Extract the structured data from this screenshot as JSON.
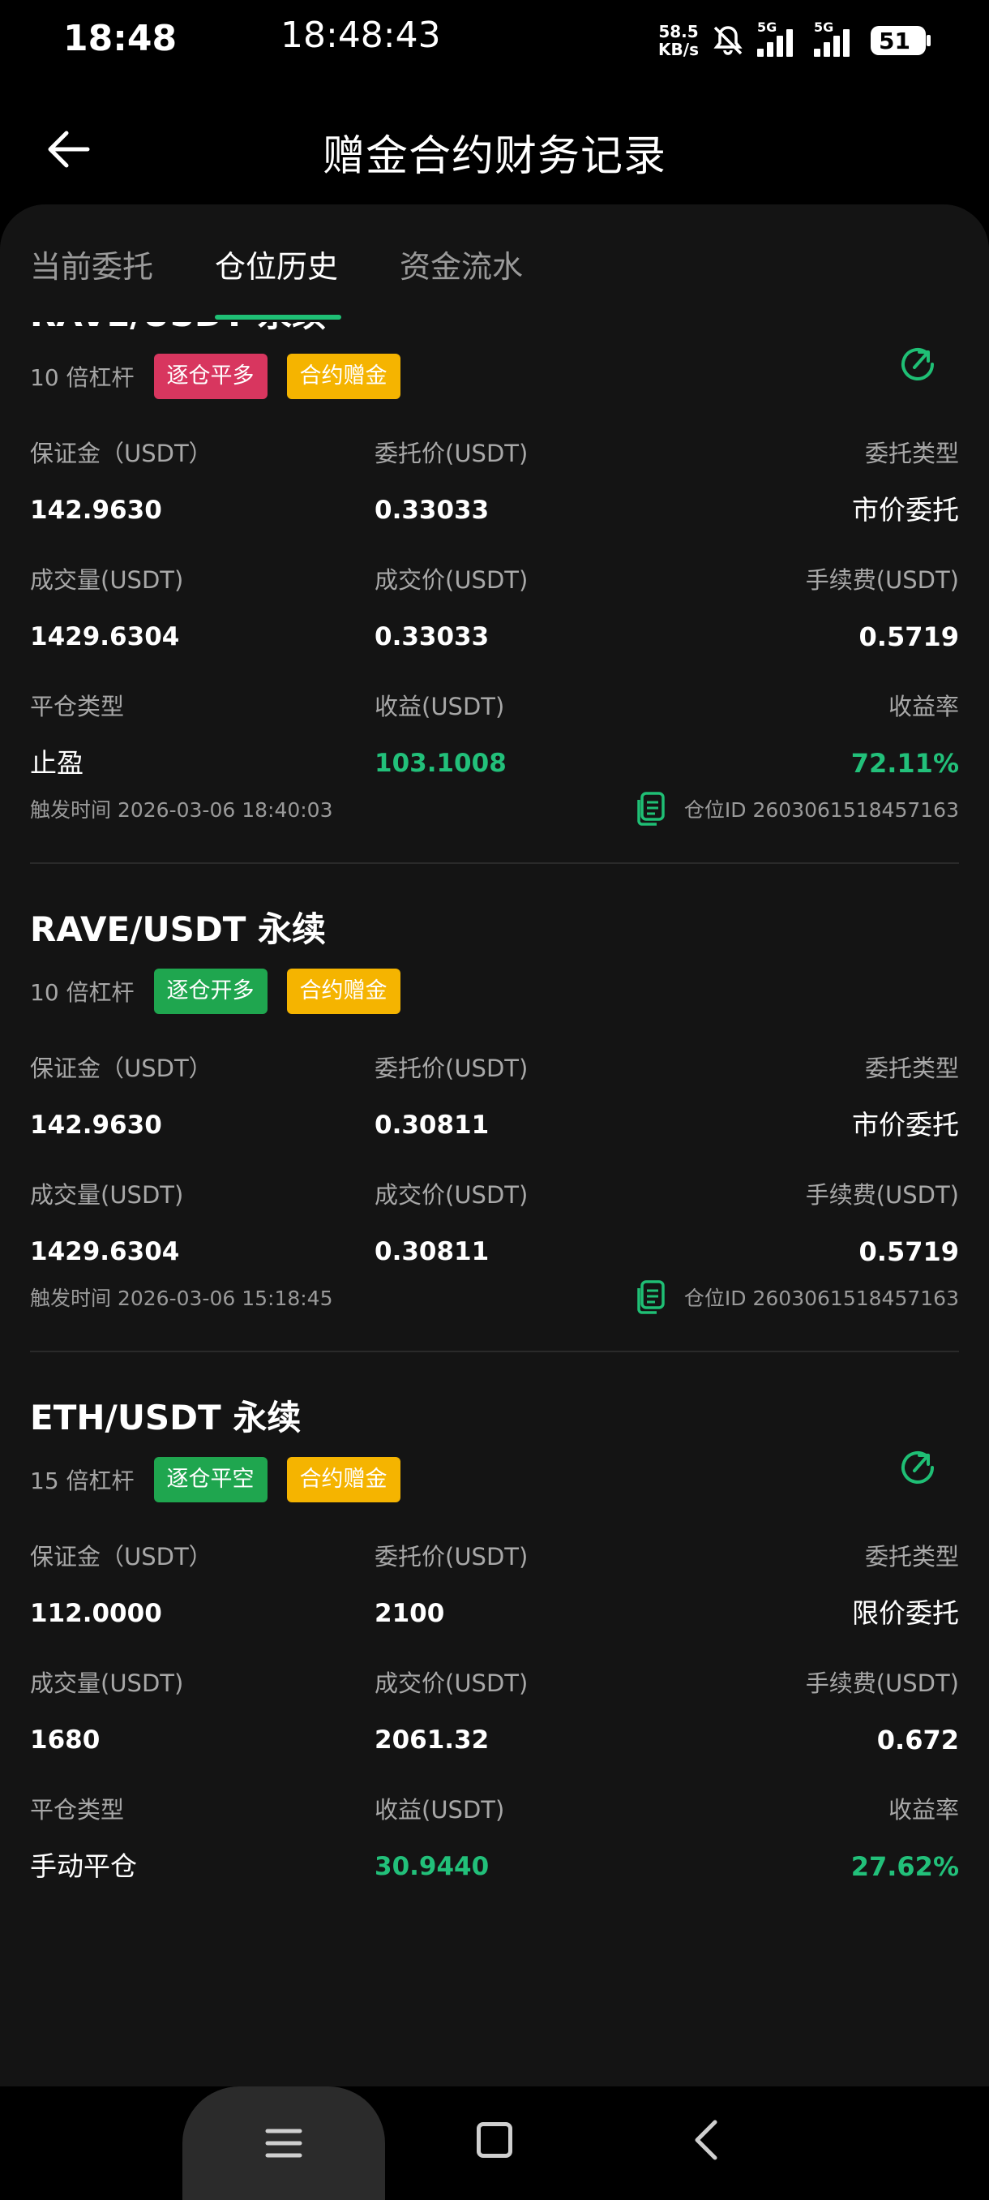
{
  "status_bar": {
    "time": "18:48",
    "clock": "18:48:43",
    "net_speed_value": "58.5",
    "net_speed_unit": "KB/s",
    "sim1": "5G",
    "sim2": "5G",
    "battery": "51"
  },
  "header": {
    "title": "赠金合约财务记录"
  },
  "tabs": [
    {
      "label": "当前委托",
      "active": false
    },
    {
      "label": "仓位历史",
      "active": true
    },
    {
      "label": "资金流水",
      "active": false
    }
  ],
  "labels": {
    "margin": "保证金（USDT）",
    "order_price": "委托价(USDT)",
    "order_type": "委托类型",
    "volume": "成交量(USDT)",
    "fill_price": "成交价(USDT)",
    "fee": "手续费(USDT)",
    "close_type": "平仓类型",
    "pnl": "收益(USDT)",
    "pnl_rate": "收益率",
    "trigger_time": "触发时间",
    "position_id": "仓位ID"
  },
  "records": [
    {
      "title": "RAVE/USDT 永续",
      "leverage": "10 倍杠杆",
      "badge1": "逐仓平多",
      "badge2": "合约赠金",
      "margin": "142.9630",
      "order_price": "0.33033",
      "order_type": "市价委托",
      "volume": "1429.6304",
      "fill_price": "0.33033",
      "fee": "0.5719",
      "close_type": "止盈",
      "pnl": "103.1008",
      "pnl_rate": "72.11%",
      "trigger_time": "2026-03-06 18:40:03",
      "position_id": "2603061518457163"
    },
    {
      "title": "RAVE/USDT 永续",
      "leverage": "10 倍杠杆",
      "badge1": "逐仓开多",
      "badge2": "合约赠金",
      "margin": "142.9630",
      "order_price": "0.30811",
      "order_type": "市价委托",
      "volume": "1429.6304",
      "fill_price": "0.30811",
      "fee": "0.5719",
      "trigger_time": "2026-03-06 15:18:45",
      "position_id": "2603061518457163"
    },
    {
      "title": "ETH/USDT 永续",
      "leverage": "15 倍杠杆",
      "badge1": "逐仓平空",
      "badge2": "合约赠金",
      "margin": "112.0000",
      "order_price": "2100",
      "order_type": "限价委托",
      "volume": "1680",
      "fill_price": "2061.32",
      "fee": "0.672",
      "close_type": "手动平仓",
      "pnl": "30.9440",
      "pnl_rate": "27.62%"
    }
  ],
  "colors": {
    "accent_green": "#1fbf75",
    "profit_green": "#22c07a",
    "badge_red": "#d8365f",
    "badge_green": "#1fa64f",
    "badge_gold": "#f5b400"
  }
}
